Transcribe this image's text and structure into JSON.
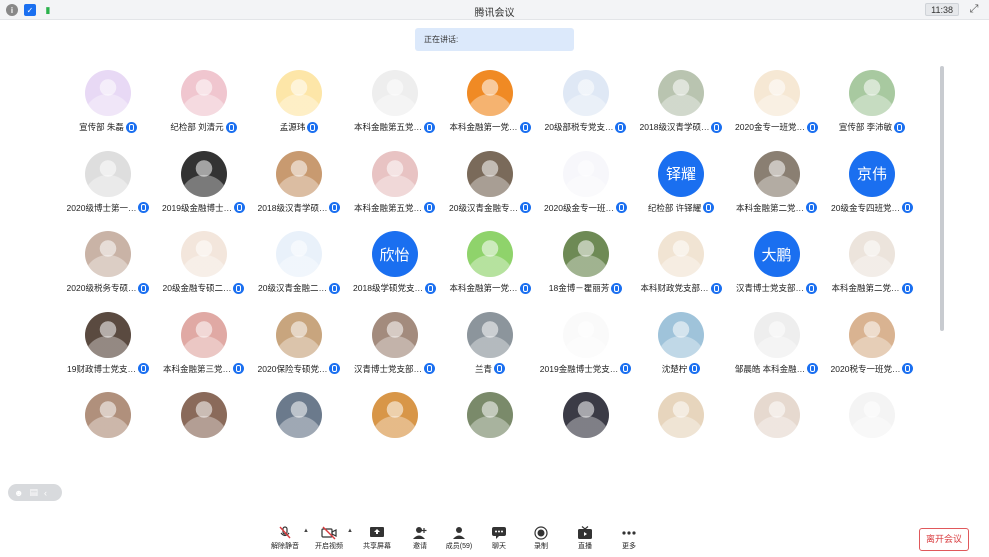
{
  "window": {
    "title": "腾讯会议",
    "time": "11:38",
    "fullscreen_icon": "fullscreen-icon"
  },
  "speaking": {
    "label": "正在讲话:"
  },
  "participants": [
    {
      "name": "宣传部 朱磊",
      "avatar": "anime-girl-purple",
      "bg": "#e8d9f5"
    },
    {
      "name": "纪检部 刘清元",
      "avatar": "cartoon-couple",
      "bg": "#f0c6cf"
    },
    {
      "name": "孟源玮",
      "avatar": "yellow-duck",
      "bg": "#fde6a8"
    },
    {
      "name": "本科金融第五党…",
      "avatar": "white-hair-anime",
      "bg": "#eeeeee"
    },
    {
      "name": "本科金融第一党…",
      "avatar": "orange-cat",
      "bg": "#f08a24"
    },
    {
      "name": "20级部税专党支…",
      "avatar": "crayon-shin",
      "bg": "#dfe8f5"
    },
    {
      "name": "2018级汉青学硕…",
      "avatar": "girl-photo",
      "bg": "#b9c4b0"
    },
    {
      "name": "2020金专一班党…",
      "avatar": "shiba-dog",
      "bg": "#f6e8d4"
    },
    {
      "name": "宣传部 李沛敏",
      "avatar": "green-anime",
      "bg": "#a8c9a0"
    },
    {
      "name": "2020级博士第一…",
      "avatar": "white-cat",
      "bg": "#dedede"
    },
    {
      "name": "2019级金融博士…",
      "avatar": "black-hair-girl",
      "bg": "#333333"
    },
    {
      "name": "2018级汉青学硕…",
      "avatar": "brown-anime",
      "bg": "#c89a70"
    },
    {
      "name": "本科金融第五党…",
      "avatar": "pink-cat",
      "bg": "#e8c3c3"
    },
    {
      "name": "20级汉青金融专…",
      "avatar": "man-photo",
      "bg": "#7a6a5a"
    },
    {
      "name": "2020级金专一班…",
      "avatar": "white-face",
      "bg": "#f7f7fb"
    },
    {
      "name": "纪检部 许铎耀",
      "avatar_text": "铎耀",
      "bg": "#1a6ff0"
    },
    {
      "name": "本科金融第二党…",
      "avatar": "girl-dark",
      "bg": "#8a7f72"
    },
    {
      "name": "20级金专四班党…",
      "avatar_text": "京伟",
      "bg": "#1a6ff0"
    },
    {
      "name": "2020级税务专硕…",
      "avatar": "room-photo",
      "bg": "#c9b3a6"
    },
    {
      "name": "20级金融专硕二…",
      "avatar": "drawn-girl",
      "bg": "#f3e6dc"
    },
    {
      "name": "20级汉青金融二…",
      "avatar": "rainbow-ghost",
      "bg": "#e9f1fa"
    },
    {
      "name": "2018级学硕党支…",
      "avatar_text": "欣怡",
      "bg": "#1a6ff0"
    },
    {
      "name": "本科金融第一党…",
      "avatar": "green-frog",
      "bg": "#8fd36b"
    },
    {
      "name": "18金博－瞿丽芳",
      "avatar": "grad-photo",
      "bg": "#6e8a55"
    },
    {
      "name": "本科财政党支部…",
      "avatar": "teddy-bear",
      "bg": "#f1e4d3"
    },
    {
      "name": "汉青博士党支部…",
      "avatar_text": "大鹏",
      "bg": "#1a6ff0"
    },
    {
      "name": "本科金融第二党…",
      "avatar": "blonde-girl",
      "bg": "#ece4dc"
    },
    {
      "name": "19财政博士党支…",
      "avatar": "man-hacker",
      "bg": "#5a4a40"
    },
    {
      "name": "本科金融第三党…",
      "avatar": "smiling-girl",
      "bg": "#e0a9a4"
    },
    {
      "name": "2020保险专硕党…",
      "avatar": "anime-brown-hair",
      "bg": "#c8a57e"
    },
    {
      "name": "汉青博士党支部…",
      "avatar": "couple-photo",
      "bg": "#a38b7d"
    },
    {
      "name": "兰青",
      "avatar": "foggy-photo",
      "bg": "#8c959c"
    },
    {
      "name": "2019金融博士党支…",
      "avatar": "white-blob",
      "bg": "#fafafa"
    },
    {
      "name": "沈楚柠",
      "avatar": "girl-sky",
      "bg": "#9fc3da"
    },
    {
      "name": "邹晨皓 本科金融…",
      "avatar": "boy-sketch",
      "bg": "#eeeeee"
    },
    {
      "name": "2020税专一班党…",
      "avatar": "cat-photo",
      "bg": "#d9b391"
    },
    {
      "name": "",
      "avatar": "girl-row5-1",
      "bg": "#b0907c"
    },
    {
      "name": "",
      "avatar": "girl-row5-2",
      "bg": "#8a6a5a"
    },
    {
      "name": "",
      "avatar": "anime-row5-3",
      "bg": "#6b7a8c"
    },
    {
      "name": "",
      "avatar": "orange-row5-4",
      "bg": "#d89648"
    },
    {
      "name": "",
      "avatar": "street-row5-5",
      "bg": "#7a8a6a"
    },
    {
      "name": "",
      "avatar": "dark-girl-row5-6",
      "bg": "#3b3b46"
    },
    {
      "name": "",
      "avatar": "pastry-row5-7",
      "bg": "#e7d5bd"
    },
    {
      "name": "",
      "avatar": "girl-row5-8",
      "bg": "#e6d9cf"
    },
    {
      "name": "",
      "avatar": "white-row5-9",
      "bg": "#f4f4f4"
    }
  ],
  "toolbar": {
    "unmute": "解除静音",
    "start_video": "开启视频",
    "share_screen": "共享屏幕",
    "invite": "邀请",
    "members": "成员(59)",
    "chat": "聊天",
    "record": "录制",
    "live": "直播",
    "more": "更多"
  },
  "leave": {
    "label": "离开会议"
  }
}
